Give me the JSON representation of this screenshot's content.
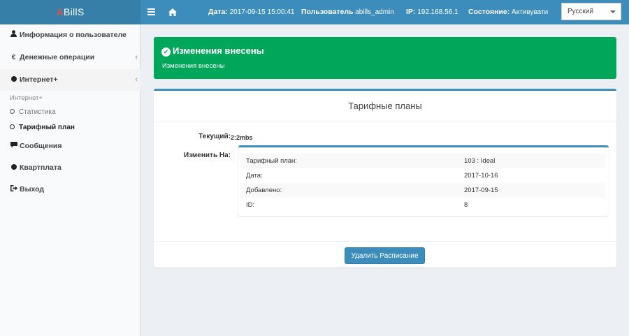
{
  "header": {
    "logo_accent": "A",
    "logo_rest": "BillS",
    "menu_icon": "menu-icon",
    "home_icon": "home-icon",
    "date_label": "Дата:",
    "date_value": "2017-09-15 15:00:41",
    "user_label": "Пользователь",
    "user_value": "abills_admin",
    "ip_label": "IP:",
    "ip_value": "192.168.56.1",
    "state_label": "Состояние:",
    "state_value": "Активувати",
    "language": "Русский"
  },
  "sidebar": {
    "items": [
      {
        "icon": "user-icon",
        "label": "Информация о пользователе"
      },
      {
        "icon": "euro-icon",
        "label": "Денежные операции",
        "arrow": "‹"
      },
      {
        "icon": "circle-icon",
        "label": "Интернет+",
        "arrow": "‹"
      },
      {
        "icon": "comment-icon",
        "label": "Сообщения"
      },
      {
        "icon": "circle-icon",
        "label": "Квартплата"
      },
      {
        "icon": "logout-icon",
        "label": "Выход"
      }
    ],
    "sub_header": "Интернет+",
    "sub_items": [
      {
        "label": "Статистика"
      },
      {
        "label": "Тарифный план"
      }
    ]
  },
  "alert": {
    "title": "Изменения внесены",
    "text": "Изменения внесены",
    "color": "#00a65a"
  },
  "box": {
    "title": "Тарифные планы",
    "current_label": "Текущий:",
    "current_value": "2:2mbs",
    "change_label": "Изменить На:",
    "rows": [
      {
        "key": "Тарифный план:",
        "value": "103 : Ideal"
      },
      {
        "key": "Дата:",
        "value": "2017-10-16"
      },
      {
        "key": "Добавлено:",
        "value": "2017-09-15"
      },
      {
        "key": "ID:",
        "value": "8"
      }
    ],
    "button_label": "Удалить Расписание"
  },
  "colors": {
    "primary": "#3c8dbc",
    "success": "#00a65a",
    "logo_accent": "#d9534f"
  }
}
